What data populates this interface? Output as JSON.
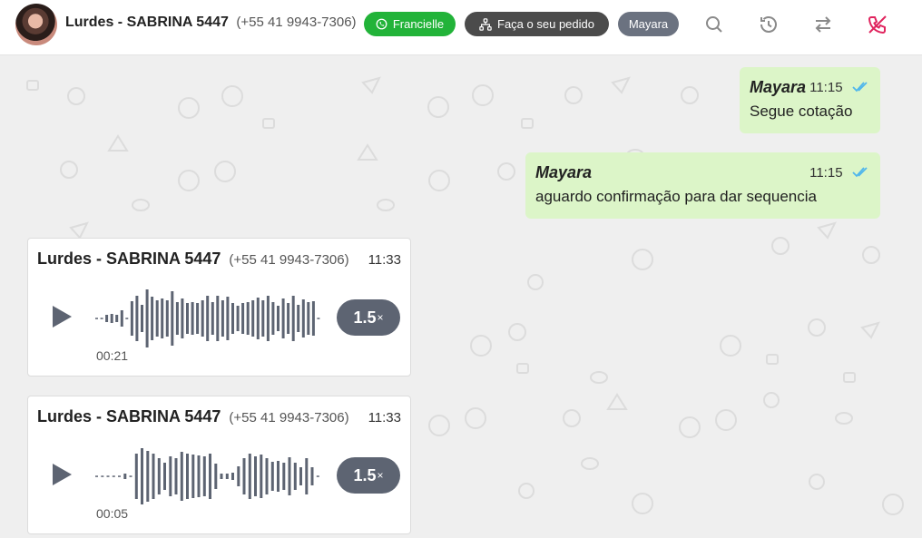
{
  "header": {
    "contact_name": "Lurdes - SABRINA 5447",
    "contact_phone": "(+55 41 9943-7306)",
    "tags": {
      "green": "Francielle",
      "dark": "Faça o seu pedido",
      "gray": "Mayara"
    },
    "icons": [
      "search-icon",
      "history-icon",
      "transfer-icon",
      "end-call-icon"
    ]
  },
  "messages": [
    {
      "sender": "Mayara",
      "time": "11:15",
      "text": "Segue cotação"
    },
    {
      "sender": "Mayara",
      "time": "11:15",
      "text": "aguardo confirmação para dar sequencia"
    }
  ],
  "audios": [
    {
      "sender": "Lurdes - SABRINA 5447",
      "phone": "(+55 41 9943-7306)",
      "time": "11:33",
      "duration": "00:21",
      "speed": "1.5",
      "speed_suffix": "×"
    },
    {
      "sender": "Lurdes - SABRINA 5447",
      "phone": "(+55 41 9943-7306)",
      "time": "11:33",
      "duration": "00:05",
      "speed": "1.5",
      "speed_suffix": "×"
    }
  ],
  "colors": {
    "header_bg": "#ffffff",
    "chat_bg": "#efefef",
    "outgoing_bubble": "#dcf5c8",
    "tag_green": "#22b339",
    "tag_dark": "#4b4b4b",
    "tag_gray": "#6b7280",
    "read_ticks": "#4fb6ec",
    "end_call": "#e0245e"
  }
}
